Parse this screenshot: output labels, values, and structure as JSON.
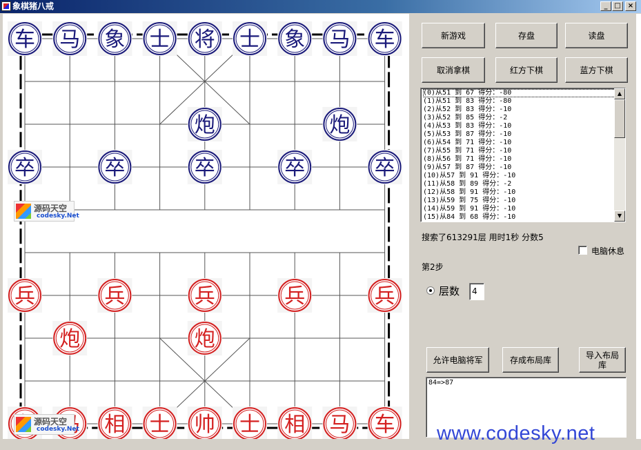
{
  "window": {
    "title": "象棋猪八戒",
    "minimize": "_",
    "maximize": "□",
    "close": "×"
  },
  "board": {
    "blue_color": "#1a1a7a",
    "red_color": "#d42020",
    "pieces_blue": [
      {
        "char": "车",
        "file": 0,
        "rank": 0
      },
      {
        "char": "马",
        "file": 1,
        "rank": 0
      },
      {
        "char": "象",
        "file": 2,
        "rank": 0
      },
      {
        "char": "士",
        "file": 3,
        "rank": 0
      },
      {
        "char": "将",
        "file": 4,
        "rank": 0
      },
      {
        "char": "士",
        "file": 5,
        "rank": 0
      },
      {
        "char": "象",
        "file": 6,
        "rank": 0
      },
      {
        "char": "马",
        "file": 7,
        "rank": 0
      },
      {
        "char": "车",
        "file": 8,
        "rank": 0
      },
      {
        "char": "炮",
        "file": 4,
        "rank": 2
      },
      {
        "char": "炮",
        "file": 7,
        "rank": 2
      },
      {
        "char": "卒",
        "file": 0,
        "rank": 3
      },
      {
        "char": "卒",
        "file": 2,
        "rank": 3
      },
      {
        "char": "卒",
        "file": 4,
        "rank": 3
      },
      {
        "char": "卒",
        "file": 6,
        "rank": 3
      },
      {
        "char": "卒",
        "file": 8,
        "rank": 3
      }
    ],
    "pieces_red": [
      {
        "char": "兵",
        "file": 0,
        "rank": 6
      },
      {
        "char": "兵",
        "file": 2,
        "rank": 6
      },
      {
        "char": "兵",
        "file": 4,
        "rank": 6
      },
      {
        "char": "兵",
        "file": 6,
        "rank": 6
      },
      {
        "char": "兵",
        "file": 8,
        "rank": 6
      },
      {
        "char": "炮",
        "file": 1,
        "rank": 7
      },
      {
        "char": "炮",
        "file": 4,
        "rank": 7
      },
      {
        "char": "车",
        "file": 0,
        "rank": 9
      },
      {
        "char": "马",
        "file": 1,
        "rank": 9
      },
      {
        "char": "相",
        "file": 2,
        "rank": 9
      },
      {
        "char": "士",
        "file": 3,
        "rank": 9
      },
      {
        "char": "帅",
        "file": 4,
        "rank": 9
      },
      {
        "char": "士",
        "file": 5,
        "rank": 9
      },
      {
        "char": "相",
        "file": 6,
        "rank": 9
      },
      {
        "char": "马",
        "file": 7,
        "rank": 9
      },
      {
        "char": "车",
        "file": 8,
        "rank": 9
      }
    ],
    "logo_text_cn": "源码天空",
    "logo_text_en": "codesky.Net"
  },
  "buttons": {
    "new_game": "新游戏",
    "save": "存盘",
    "load": "读盘",
    "undo": "取消拿棋",
    "red_move": "红方下棋",
    "blue_move": "蓝方下棋",
    "allow_check": "允许电脑将军",
    "save_opening": "存成布局库",
    "import_opening": "导入布局库"
  },
  "move_list": [
    "(0)从51 到 67 得分：-80",
    "(1)从51 到 83 得分：-80",
    "(2)从52 到 83 得分：-10",
    "(3)从52 到 85 得分：-2",
    "(4)从53 到 83 得分：-10",
    "(5)从53 到 87 得分：-10",
    "(6)从54 到 71 得分：-10",
    "(7)从55 到 71 得分：-10",
    "(8)从56 到 71 得分：-10",
    "(9)从57 到 87 得分：-10",
    "(10)从57 到 91 得分：-10",
    "(11)从58 到 89 得分：-2",
    "(12)从58 到 91 得分：-10",
    "(13)从59 到 75 得分：-10",
    "(14)从59 到 91 得分：-10",
    "(15)从84 到 68 得分：-10"
  ],
  "status": {
    "search_info": "搜索了613291层   用时1秒  分数5",
    "computer_rest_label": "电脑休息",
    "computer_rest_checked": false,
    "step_label": "第2步",
    "depth_label": "层数",
    "depth_value": "4",
    "depth_selected": true
  },
  "log_text": "84=>87",
  "watermark": "www.codesky.net"
}
